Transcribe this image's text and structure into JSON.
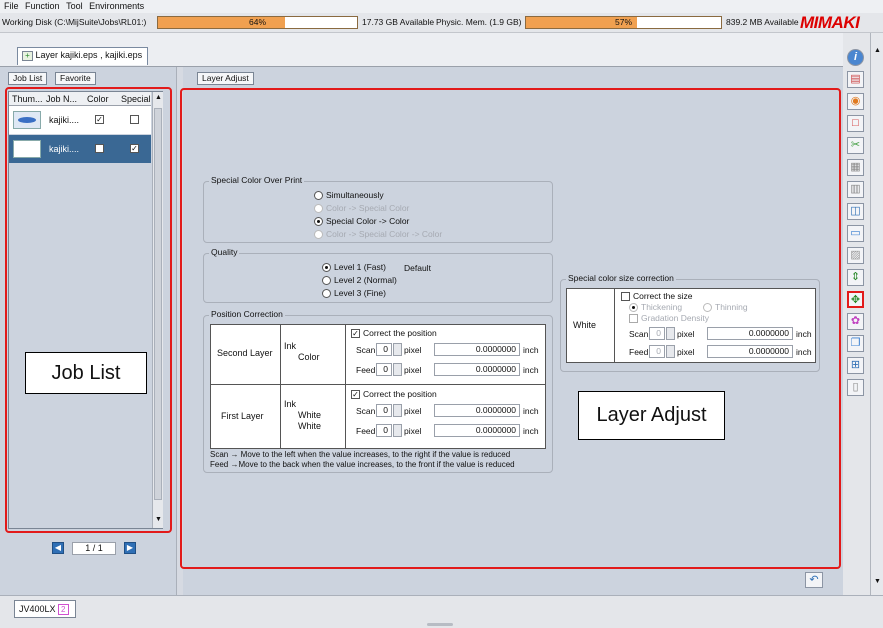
{
  "menu": [
    "File",
    "Function",
    "Tool",
    "Environments"
  ],
  "status": {
    "working_disk_label": "Working Disk (C:\\MijSuite\\Jobs\\RL01:)",
    "disk_percent": "64%",
    "disk_fill": 0.64,
    "disk_available": "17.73 GB Available",
    "memory_label": "Physic. Mem. (1.9 GB)",
    "memory_percent": "57%",
    "memory_fill": 0.57,
    "memory_available": "839.2 MB Available",
    "logo": "MIMAKI"
  },
  "document_tab": {
    "prefix": "Layer",
    "name": "kajiki.eps , kajiki.eps"
  },
  "left_tabs": [
    "Job List",
    "Favorite"
  ],
  "job_table": {
    "headers": [
      "Thum...",
      "Job N...",
      "Color",
      "Special"
    ],
    "rows": [
      {
        "name": "kajiki....",
        "color": true,
        "special": false,
        "selected": false
      },
      {
        "name": "kajiki....",
        "color": false,
        "special": true,
        "selected": true
      }
    ]
  },
  "pager": {
    "page": "1 / 1"
  },
  "right_tab": "Layer Adjust",
  "special_color": {
    "title": "Special Color Over Print",
    "options": [
      {
        "label": "Simultaneously",
        "selected": false,
        "enabled": true
      },
      {
        "label": "Color -> Special Color",
        "selected": false,
        "enabled": false
      },
      {
        "label": "Special Color -> Color",
        "selected": true,
        "enabled": true
      },
      {
        "label": "Color -> Special Color -> Color",
        "selected": false,
        "enabled": false
      }
    ]
  },
  "quality": {
    "title": "Quality",
    "options": [
      {
        "label": "Level 1 (Fast)",
        "selected": true
      },
      {
        "label": "Level 2 (Normal)",
        "selected": false
      },
      {
        "label": "Level 3 (Fine)",
        "selected": false
      }
    ],
    "default_label": "Default"
  },
  "position": {
    "title": "Position Correction",
    "second": {
      "layer": "Second Layer",
      "ink": "Ink",
      "inks": [
        "Color"
      ],
      "check": "Correct the position",
      "scan_label": "Scan",
      "scan": "0",
      "scan_value": "0.0000000",
      "feed_label": "Feed",
      "feed": "0",
      "feed_value": "0.0000000"
    },
    "first": {
      "layer": "First Layer",
      "ink": "Ink",
      "inks": [
        "White",
        "White"
      ],
      "check": "Correct the position",
      "scan_label": "Scan",
      "scan": "0",
      "scan_value": "0.0000000",
      "feed_label": "Feed",
      "feed": "0",
      "feed_value": "0.0000000"
    },
    "pixel": "pixel",
    "inch": "inch",
    "note1": "Scan → Move to the left when the value increases, to the right if the value is reduced",
    "note2": "Feed →Move to the back when the value increases, to the front if the value is reduced"
  },
  "size_correction": {
    "title": "Special color size correction",
    "ink": "White",
    "check": "Correct the size",
    "thickening": "Thickening",
    "thinning": "Thinning",
    "gradation": "Gradation Density",
    "scan_label": "Scan",
    "scan": "0",
    "scan_value": "0.0000000",
    "feed_label": "Feed",
    "feed": "0",
    "feed_value": "0.0000000",
    "pixel": "pixel",
    "inch": "inch"
  },
  "callouts": {
    "job_list": "Job List",
    "layer_adjust": "Layer Adjust"
  },
  "bottom_tab": {
    "label": "JV400LX",
    "badge": "2"
  },
  "side_icons": [
    "info-icon",
    "layer-icon",
    "color-icon",
    "frame-icon",
    "cut-icon",
    "tile-icon",
    "step-icon",
    "window-icon",
    "stack-icon",
    "arrow-icon",
    "layer-adjust-icon",
    "color-wheel-icon",
    "copy-icon",
    "split-icon",
    "trash-icon"
  ]
}
